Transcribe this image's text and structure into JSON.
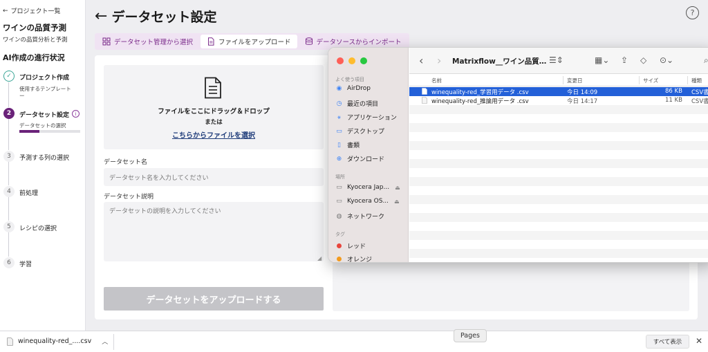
{
  "sidebar": {
    "back_label": "プロジェクト一覧",
    "project_title": "ワインの品質予測",
    "project_subtitle": "ワインの品質分析と予測",
    "progress_heading": "AI作成の進行状況",
    "steps": [
      {
        "num": "✓",
        "label": "プロジェクト作成",
        "note": "使用するテンプレート",
        "note2": "ー",
        "state": "done"
      },
      {
        "num": "2",
        "label": "データセット設定",
        "note": "データセットの選択",
        "state": "active",
        "progress": 0.33
      },
      {
        "num": "3",
        "label": "予測する列の選択",
        "state": "idle"
      },
      {
        "num": "4",
        "label": "前処理",
        "state": "idle"
      },
      {
        "num": "5",
        "label": "レシピの選択",
        "state": "idle"
      },
      {
        "num": "6",
        "label": "学習",
        "state": "idle"
      }
    ]
  },
  "header": {
    "title": "データセット設定"
  },
  "tabs": [
    {
      "label": "データセット管理から選択",
      "icon": "dataset-icon",
      "active": false
    },
    {
      "label": "ファイルをアップロード",
      "icon": "file-icon",
      "active": true
    },
    {
      "label": "データソースからインポート",
      "icon": "database-icon",
      "active": false
    }
  ],
  "upload": {
    "drop_text": "ファイルをここにドラッグ＆ドロップ",
    "or_text": "または",
    "select_link": "こちらからファイルを選択",
    "name_label": "データセット名",
    "name_placeholder": "データセット名を入力してください",
    "desc_label": "データセット説明",
    "desc_placeholder": "データセットの説明を入力してください",
    "submit_label": "データセットをアップロードする"
  },
  "finder": {
    "title": "Matrixflow__ワイン品質…",
    "favorites_label": "よく使う項目",
    "favorites": [
      {
        "label": "AirDrop",
        "icon": "airdrop-icon",
        "glyph": "◉"
      },
      {
        "label": "最近の項目",
        "icon": "clock-icon",
        "glyph": "◷"
      },
      {
        "label": "アプリケーション",
        "icon": "apps-icon",
        "glyph": "⚹"
      },
      {
        "label": "デスクトップ",
        "icon": "desktop-icon",
        "glyph": "▭"
      },
      {
        "label": "書類",
        "icon": "document-icon",
        "glyph": "▯"
      },
      {
        "label": "ダウンロード",
        "icon": "download-icon",
        "glyph": "⊕"
      }
    ],
    "locations_label": "場所",
    "locations": [
      {
        "label": "Kyocera Jap...",
        "icon": "drive-icon",
        "glyph": "▭"
      },
      {
        "label": "Kyocera OS...",
        "icon": "drive-icon",
        "glyph": "▭"
      },
      {
        "label": "ネットワーク",
        "icon": "network-icon",
        "glyph": "◍"
      }
    ],
    "tags_label": "タグ",
    "tags": [
      {
        "label": "レッド",
        "color": "#e8453c"
      },
      {
        "label": "オレンジ",
        "color": "#f39a1e"
      }
    ],
    "columns": {
      "name": "名前",
      "date": "変更日",
      "size": "サイズ",
      "kind": "種類"
    },
    "files": [
      {
        "name": "winequality-red_学習用データ .csv",
        "date": "今日 14:09",
        "size": "86 KB",
        "kind": "CSV書",
        "selected": true
      },
      {
        "name": "winequality-red_推論用データ .csv",
        "date": "今日 14:17",
        "size": "11 KB",
        "kind": "CSV書",
        "selected": false
      }
    ]
  },
  "download_bar": {
    "file_name": "winequality-red_....csv",
    "show_all": "すべて表示",
    "pages_tooltip": "Pages"
  },
  "colors": {
    "accent": "#6a2279",
    "done": "#3aa596",
    "selection": "#2360d8"
  }
}
